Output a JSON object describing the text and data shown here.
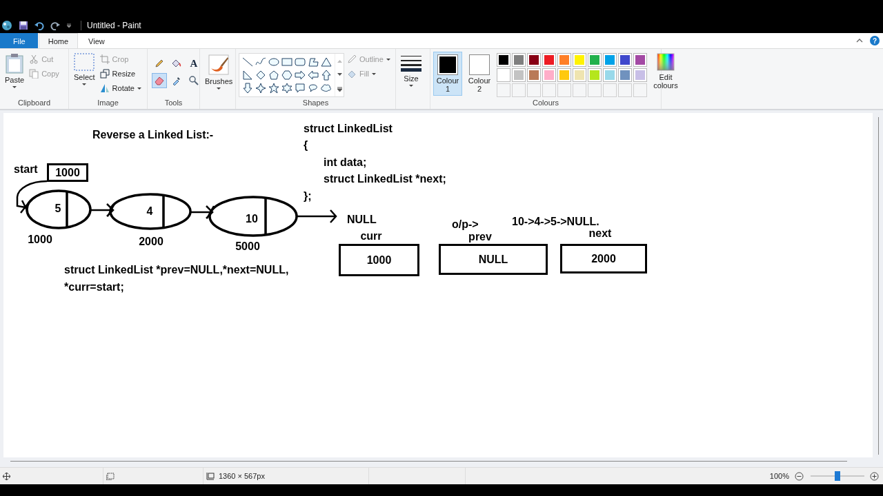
{
  "window": {
    "title": "Untitled - Paint",
    "help": "?"
  },
  "tabs": [
    {
      "label": "File",
      "kind": "file",
      "selected": false
    },
    {
      "label": "Home",
      "kind": "tab",
      "selected": true
    },
    {
      "label": "View",
      "kind": "tab",
      "selected": false
    }
  ],
  "ribbon": {
    "clipboard": {
      "label": "Clipboard",
      "paste": "Paste",
      "cut": {
        "label": "Cut",
        "disabled": true
      },
      "copy": {
        "label": "Copy",
        "disabled": true
      }
    },
    "image": {
      "label": "Image",
      "select": "Select",
      "crop": {
        "label": "Crop",
        "disabled": true
      },
      "resize": {
        "label": "Resize",
        "disabled": false
      },
      "rotate": {
        "label": "Rotate",
        "disabled": false
      }
    },
    "tools": {
      "label": "Tools",
      "items": [
        {
          "kind": "pencil",
          "selected": false
        },
        {
          "kind": "fill",
          "selected": false
        },
        {
          "kind": "text",
          "glyph": "A",
          "selected": false
        },
        {
          "kind": "eraser",
          "selected": true
        },
        {
          "kind": "picker",
          "selected": false
        },
        {
          "kind": "magnifier",
          "selected": false
        }
      ]
    },
    "brushes": {
      "label": "Brushes"
    },
    "shapes": {
      "label": "Shapes",
      "outline": {
        "label": "Outline",
        "disabled": true
      },
      "fill": {
        "label": "Fill",
        "disabled": true
      }
    },
    "size": {
      "label": "Size"
    },
    "colours": {
      "label": "Colours",
      "colour1": {
        "label": "Colour 1",
        "color": "#000000",
        "selected": true
      },
      "colour2": {
        "label": "Colour 2",
        "color": "#ffffff",
        "selected": false
      },
      "palette": [
        {
          "kind": "swatch",
          "color": "#000000"
        },
        {
          "kind": "swatch",
          "color": "#7f7f7f"
        },
        {
          "kind": "swatch",
          "color": "#880015"
        },
        {
          "kind": "swatch",
          "color": "#ed1c24"
        },
        {
          "kind": "swatch",
          "color": "#ff7f27"
        },
        {
          "kind": "swatch",
          "color": "#fff200"
        },
        {
          "kind": "swatch",
          "color": "#22b14c"
        },
        {
          "kind": "swatch",
          "color": "#00a2e8"
        },
        {
          "kind": "swatch",
          "color": "#3f48cc"
        },
        {
          "kind": "swatch",
          "color": "#a349a4"
        },
        {
          "kind": "swatch",
          "color": "#ffffff"
        },
        {
          "kind": "swatch",
          "color": "#c3c3c3"
        },
        {
          "kind": "swatch",
          "color": "#b97a57"
        },
        {
          "kind": "swatch",
          "color": "#ffaec9"
        },
        {
          "kind": "swatch",
          "color": "#ffc90e"
        },
        {
          "kind": "swatch",
          "color": "#efe4b0"
        },
        {
          "kind": "swatch",
          "color": "#b5e61d"
        },
        {
          "kind": "swatch",
          "color": "#99d9ea"
        },
        {
          "kind": "swatch",
          "color": "#7092be"
        },
        {
          "kind": "swatch",
          "color": "#c8bfe7"
        },
        {
          "kind": "empty"
        },
        {
          "kind": "empty"
        },
        {
          "kind": "empty"
        },
        {
          "kind": "empty"
        },
        {
          "kind": "empty"
        },
        {
          "kind": "empty"
        },
        {
          "kind": "empty"
        },
        {
          "kind": "empty"
        },
        {
          "kind": "empty"
        },
        {
          "kind": "empty"
        }
      ],
      "edit": "Edit colours"
    }
  },
  "canvas": {
    "title": "Reverse a Linked List:-",
    "struct_lines": [
      "struct LinkedList",
      "{",
      "int data;",
      "struct LinkedList *next;",
      "};"
    ],
    "start_label": "start",
    "start_value": "1000",
    "nodes": [
      {
        "value": "5",
        "address": "1000"
      },
      {
        "value": "4",
        "address": "2000"
      },
      {
        "value": "10",
        "address": "5000"
      }
    ],
    "tail": "NULL",
    "declaration_lines": [
      "struct LinkedList *prev=NULL,*next=NULL,",
      "*curr=start;"
    ],
    "output": {
      "label": "o/p->",
      "value": "10->4->5->NULL."
    },
    "pointers": [
      {
        "label": "curr",
        "value": "1000"
      },
      {
        "label": "prev",
        "value": "NULL"
      },
      {
        "label": "next",
        "value": "2000"
      }
    ]
  },
  "status_bar": {
    "canvas_size": "1360 × 567px",
    "zoom": "100%",
    "zoom_slider": {
      "level": 0.5
    }
  }
}
